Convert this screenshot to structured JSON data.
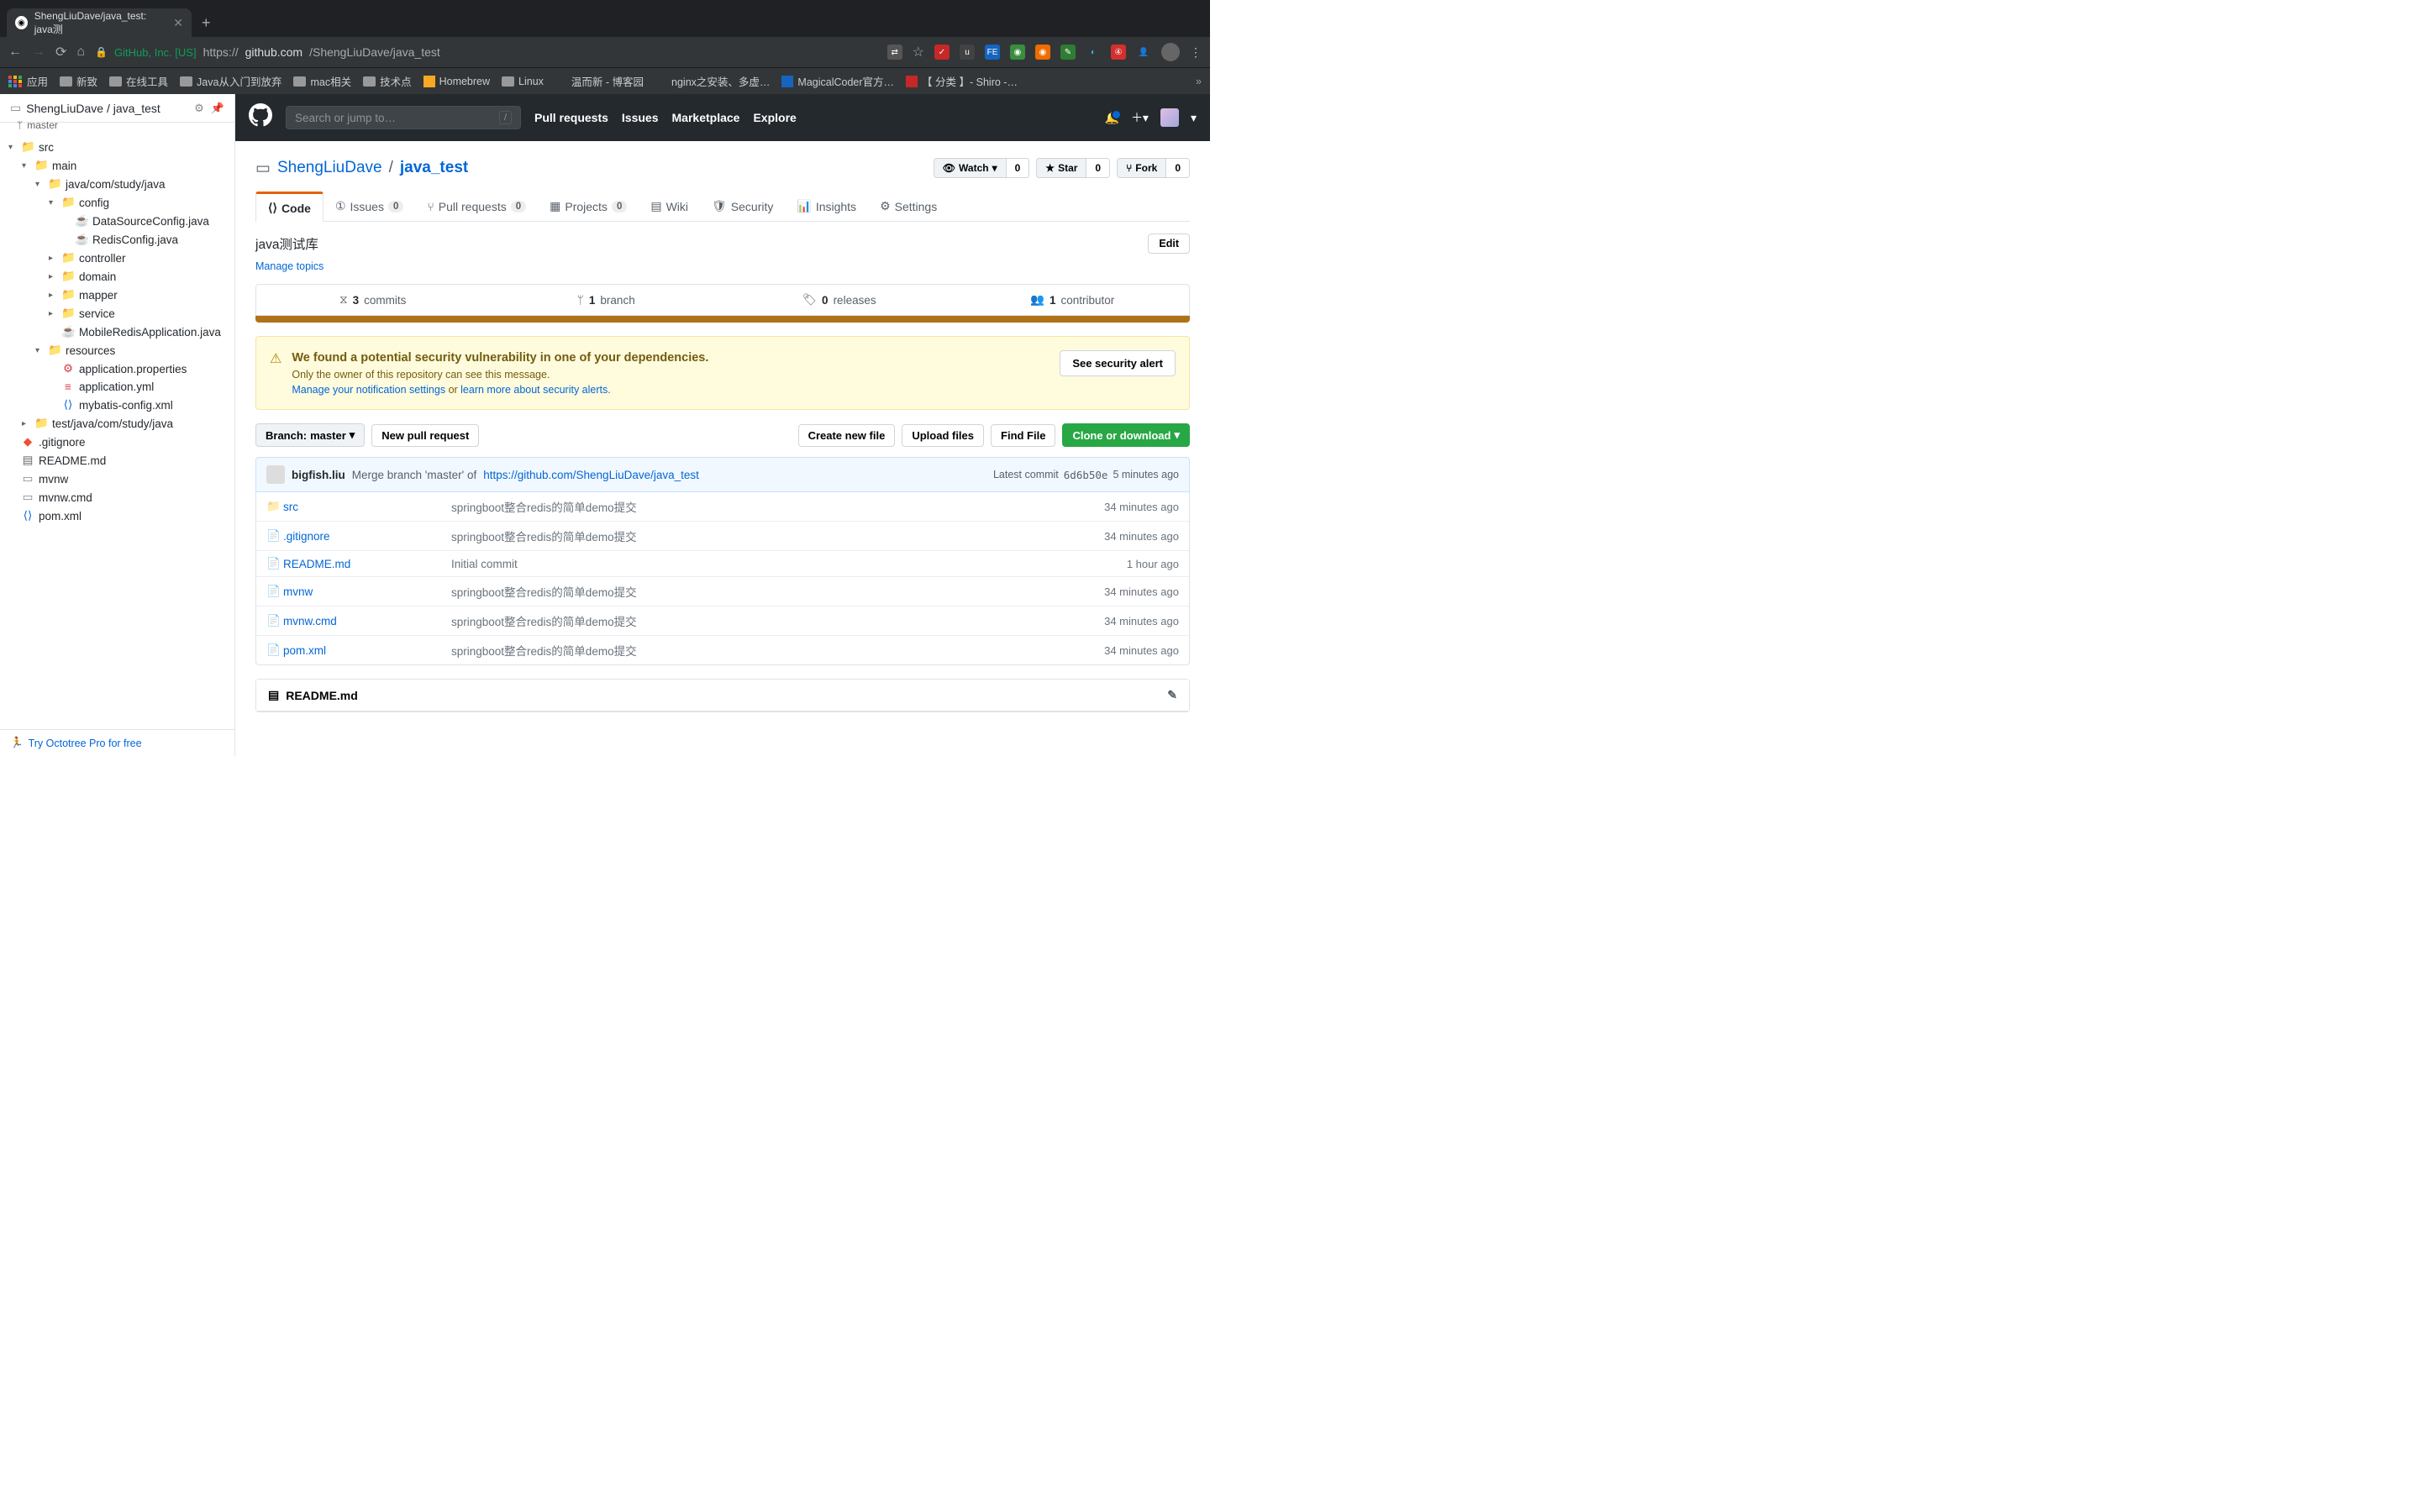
{
  "browser": {
    "tab_title": "ShengLiuDave/java_test: java测",
    "security_label": "GitHub, Inc. [US]",
    "url_prefix": "https://",
    "url_host": "github.com",
    "url_path": "/ShengLiuDave/java_test"
  },
  "bookmarks": [
    "应用",
    "新致",
    "在线工具",
    "Java从入门到放弃",
    "mac相关",
    "技术点",
    "Homebrew",
    "Linux",
    "温而新 - 博客园",
    "nginx之安装、多虚…",
    "MagicalCoder官方…",
    "【 分类 】- Shiro -…"
  ],
  "octotree": {
    "owner": "ShengLiuDave",
    "repo": "java_test",
    "branch": "master",
    "tree": [
      {
        "lvl": 0,
        "caret": "▾",
        "icon": "folder",
        "name": "src"
      },
      {
        "lvl": 1,
        "caret": "▾",
        "icon": "folder",
        "name": "main"
      },
      {
        "lvl": 2,
        "caret": "▾",
        "icon": "folder",
        "name": "java/com/study/java"
      },
      {
        "lvl": 3,
        "caret": "▾",
        "icon": "folder",
        "name": "config"
      },
      {
        "lvl": 4,
        "caret": "",
        "icon": "java",
        "name": "DataSourceConfig.java"
      },
      {
        "lvl": 4,
        "caret": "",
        "icon": "java",
        "name": "RedisConfig.java"
      },
      {
        "lvl": 3,
        "caret": "▸",
        "icon": "folder",
        "name": "controller"
      },
      {
        "lvl": 3,
        "caret": "▸",
        "icon": "folder",
        "name": "domain"
      },
      {
        "lvl": 3,
        "caret": "▸",
        "icon": "folder",
        "name": "mapper"
      },
      {
        "lvl": 3,
        "caret": "▸",
        "icon": "folder",
        "name": "service"
      },
      {
        "lvl": 3,
        "caret": "",
        "icon": "java",
        "name": "MobileRedisApplication.java"
      },
      {
        "lvl": 2,
        "caret": "▾",
        "icon": "folder",
        "name": "resources"
      },
      {
        "lvl": 3,
        "caret": "",
        "icon": "prop",
        "name": "application.properties"
      },
      {
        "lvl": 3,
        "caret": "",
        "icon": "yml",
        "name": "application.yml"
      },
      {
        "lvl": 3,
        "caret": "",
        "icon": "xml",
        "name": "mybatis-config.xml"
      },
      {
        "lvl": 1,
        "caret": "▸",
        "icon": "folder",
        "name": "test/java/com/study/java"
      },
      {
        "lvl": 0,
        "caret": "",
        "icon": "git",
        "name": ".gitignore"
      },
      {
        "lvl": 0,
        "caret": "",
        "icon": "md",
        "name": "README.md"
      },
      {
        "lvl": 0,
        "caret": "",
        "icon": "file",
        "name": "mvnw"
      },
      {
        "lvl": 0,
        "caret": "",
        "icon": "file",
        "name": "mvnw.cmd"
      },
      {
        "lvl": 0,
        "caret": "",
        "icon": "xml",
        "name": "pom.xml"
      }
    ],
    "footer": "Try Octotree Pro for free"
  },
  "gh_header": {
    "search_placeholder": "Search or jump to…",
    "slash": "/",
    "nav": [
      "Pull requests",
      "Issues",
      "Marketplace",
      "Explore"
    ]
  },
  "repo": {
    "owner": "ShengLiuDave",
    "name": "java_test",
    "watch_label": "Watch",
    "watch_count": "0",
    "star_label": "Star",
    "star_count": "0",
    "fork_label": "Fork",
    "fork_count": "0",
    "tabs": {
      "code": "Code",
      "issues": "Issues",
      "issues_count": "0",
      "pr": "Pull requests",
      "pr_count": "0",
      "projects": "Projects",
      "projects_count": "0",
      "wiki": "Wiki",
      "security": "Security",
      "insights": "Insights",
      "settings": "Settings"
    },
    "description": "java测试库",
    "edit_btn": "Edit",
    "manage_topics": "Manage topics",
    "stats": {
      "commits_n": "3",
      "commits": "commits",
      "branches_n": "1",
      "branches": "branch",
      "releases_n": "0",
      "releases": "releases",
      "contrib_n": "1",
      "contrib": "contributor"
    },
    "warning": {
      "title": "We found a potential security vulnerability in one of your dependencies.",
      "sub": "Only the owner of this repository can see this message.",
      "link1": "Manage your notification settings",
      "or": " or ",
      "link2": "learn more about security alerts.",
      "btn": "See security alert"
    },
    "toolbar": {
      "branch_label": "Branch: ",
      "branch_name": "master",
      "new_pr": "New pull request",
      "create_file": "Create new file",
      "upload": "Upload files",
      "find_file": "Find File",
      "clone": "Clone or download"
    },
    "commit_bar": {
      "author": "bigfish.liu",
      "msg": "Merge branch 'master' of ",
      "link": "https://github.com/ShengLiuDave/java_test",
      "latest": "Latest commit",
      "sha": "6d6b50e",
      "time": "5 minutes ago"
    },
    "files": [
      {
        "icon": "dir",
        "name": "src",
        "msg": "springboot整合redis的简单demo提交",
        "time": "34 minutes ago"
      },
      {
        "icon": "file",
        "name": ".gitignore",
        "msg": "springboot整合redis的简单demo提交",
        "time": "34 minutes ago"
      },
      {
        "icon": "file",
        "name": "README.md",
        "msg": "Initial commit",
        "time": "1 hour ago"
      },
      {
        "icon": "file",
        "name": "mvnw",
        "msg": "springboot整合redis的简单demo提交",
        "time": "34 minutes ago"
      },
      {
        "icon": "file",
        "name": "mvnw.cmd",
        "msg": "springboot整合redis的简单demo提交",
        "time": "34 minutes ago"
      },
      {
        "icon": "file",
        "name": "pom.xml",
        "msg": "springboot整合redis的简单demo提交",
        "time": "34 minutes ago"
      }
    ],
    "readme_title": "README.md"
  }
}
